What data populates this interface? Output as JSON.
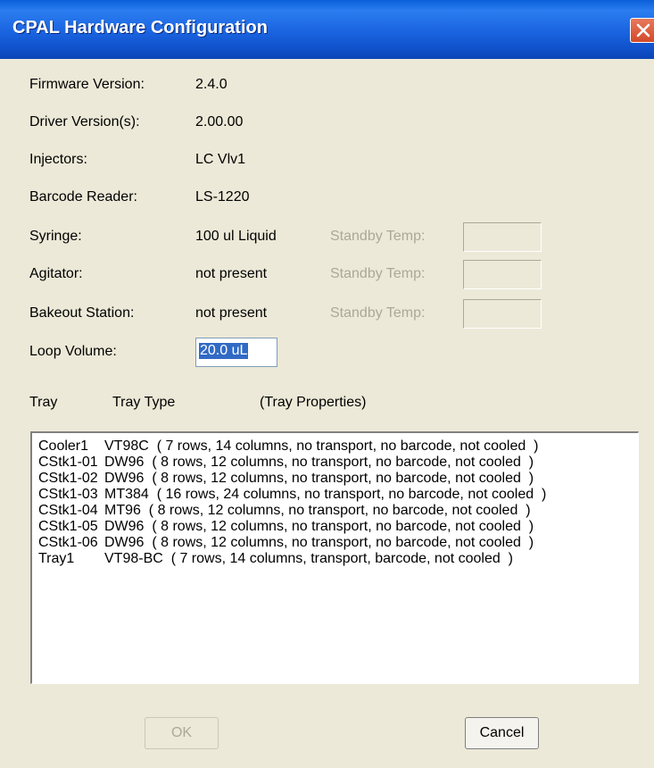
{
  "window": {
    "title": "CPAL Hardware Configuration"
  },
  "fields": {
    "firmware_label": "Firmware Version:",
    "firmware_value": "2.4.0",
    "driver_label": "Driver Version(s):",
    "driver_value": "2.00.00",
    "injectors_label": "Injectors:",
    "injectors_value": "LC Vlv1",
    "barcode_label": "Barcode Reader:",
    "barcode_value": "LS-1220",
    "syringe_label": "Syringe:",
    "syringe_value": "100 ul Liquid",
    "agitator_label": "Agitator:",
    "agitator_value": "not present",
    "bakeout_label": "Bakeout Station:",
    "bakeout_value": "not present",
    "standby_label": "Standby Temp:",
    "loop_label": "Loop Volume:",
    "loop_value": "20.0 uL"
  },
  "tray_headers": {
    "tray": "Tray",
    "type": "Tray Type",
    "props": "(Tray Properties)"
  },
  "trays": [
    {
      "name": "Cooler1",
      "desc": "VT98C  ( 7 rows, 14 columns, no transport, no barcode, not cooled  )"
    },
    {
      "name": "CStk1-01",
      "desc": "DW96  ( 8 rows, 12 columns, no transport, no barcode, not cooled  )"
    },
    {
      "name": "CStk1-02",
      "desc": "DW96  ( 8 rows, 12 columns, no transport, no barcode, not cooled  )"
    },
    {
      "name": "CStk1-03",
      "desc": "MT384  ( 16 rows, 24 columns, no transport, no barcode, not cooled  )"
    },
    {
      "name": "CStk1-04",
      "desc": "MT96  ( 8 rows, 12 columns, no transport, no barcode, not cooled  )"
    },
    {
      "name": "CStk1-05",
      "desc": "DW96  ( 8 rows, 12 columns, no transport, no barcode, not cooled  )"
    },
    {
      "name": "CStk1-06",
      "desc": "DW96  ( 8 rows, 12 columns, no transport, no barcode, not cooled  )"
    },
    {
      "name": "Tray1",
      "desc": "VT98-BC  ( 7 rows, 14 columns, transport, barcode, not cooled  )"
    }
  ],
  "buttons": {
    "ok": "OK",
    "cancel": "Cancel"
  }
}
